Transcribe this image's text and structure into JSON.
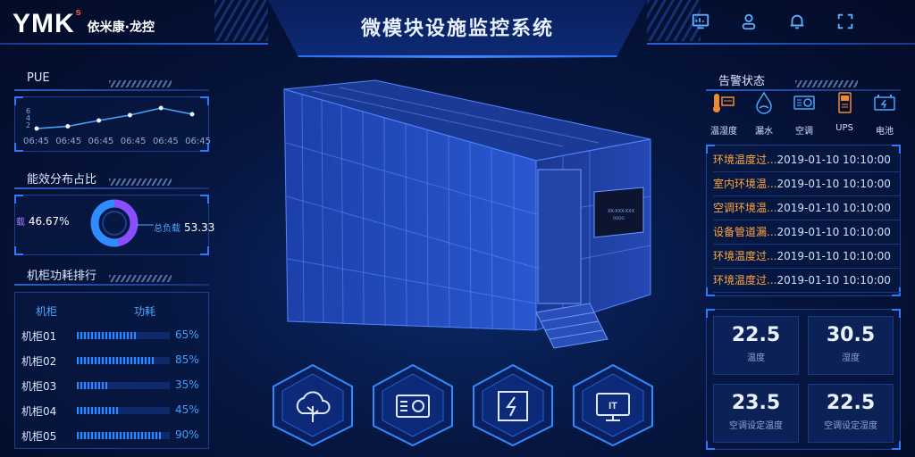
{
  "header": {
    "logo_mark": "YMK",
    "logo_superscript": "s",
    "logo_text": "依米康·龙控",
    "title": "微模块设施监控系统",
    "icons": [
      "monitor-icon",
      "user-icon",
      "bell-icon",
      "fullscreen-icon"
    ]
  },
  "pue": {
    "title": "PUE",
    "y_ticks": [
      "6",
      "4",
      "2"
    ],
    "x_ticks": [
      "06:45",
      "06:45",
      "06:45",
      "06:45",
      "06:45",
      "06:45"
    ],
    "values": [
      1.0,
      1.5,
      2.8,
      4.0,
      5.6,
      4.2
    ]
  },
  "energy": {
    "title": "能效分布占比",
    "left_tag": "载",
    "left_value": "46.67%",
    "right_tag": "总负载",
    "right_value": "53.33",
    "segments": [
      {
        "value": 46.67,
        "color": "#8a4dff"
      },
      {
        "value": 53.33,
        "color": "#2f8bff"
      }
    ]
  },
  "ranking": {
    "title": "机柜功耗排行",
    "col_name": "机柜",
    "col_power": "功耗",
    "rows": [
      {
        "name": "机柜01",
        "percent": 65,
        "label": "65%"
      },
      {
        "name": "机柜02",
        "percent": 85,
        "label": "85%"
      },
      {
        "name": "机柜03",
        "percent": 35,
        "label": "35%"
      },
      {
        "name": "机柜04",
        "percent": 45,
        "label": "45%"
      },
      {
        "name": "机柜05",
        "percent": 90,
        "label": "90%"
      }
    ]
  },
  "screen": {
    "lines": [
      "XX-XXX-XXX",
      "OOOO"
    ]
  },
  "bottom_buttons": [
    {
      "icon": "cloud-tree-icon"
    },
    {
      "icon": "ac-unit-icon"
    },
    {
      "icon": "power-icon"
    },
    {
      "icon": "it-monitor-icon",
      "text": "IT"
    }
  ],
  "alarm": {
    "title": "告警状态",
    "categories": [
      {
        "label": "温湿度",
        "icon": "thermometer-icon"
      },
      {
        "label": "漏水",
        "icon": "water-leak-icon"
      },
      {
        "label": "空调",
        "icon": "air-conditioner-icon"
      },
      {
        "label": "UPS",
        "icon": "ups-icon"
      },
      {
        "label": "电池",
        "icon": "battery-icon"
      }
    ],
    "events": [
      {
        "message": "环境温度过",
        "time": "2019-01-10 10:10:00"
      },
      {
        "message": "室内环境温",
        "time": "2019-01-10 10:10:00"
      },
      {
        "message": "空调环境温",
        "time": "2019-01-10 10:10:00"
      },
      {
        "message": "设备管道漏",
        "time": "2019-01-10 10:10:00"
      },
      {
        "message": "环境温度过",
        "time": "2019-01-10 10:10:00"
      },
      {
        "message": "环境温度过",
        "time": "2019-01-10 10:10:00"
      }
    ],
    "ellipsis": "..."
  },
  "stats": [
    {
      "value": "22.5",
      "label": "温度"
    },
    {
      "value": "30.5",
      "label": "湿度"
    },
    {
      "value": "23.5",
      "label": "空调设定温度"
    },
    {
      "value": "22.5",
      "label": "空调设定湿度"
    }
  ],
  "colors": {
    "accent": "#2f8bff",
    "alarm_text": "#ffa640",
    "purple": "#8a4dff"
  }
}
